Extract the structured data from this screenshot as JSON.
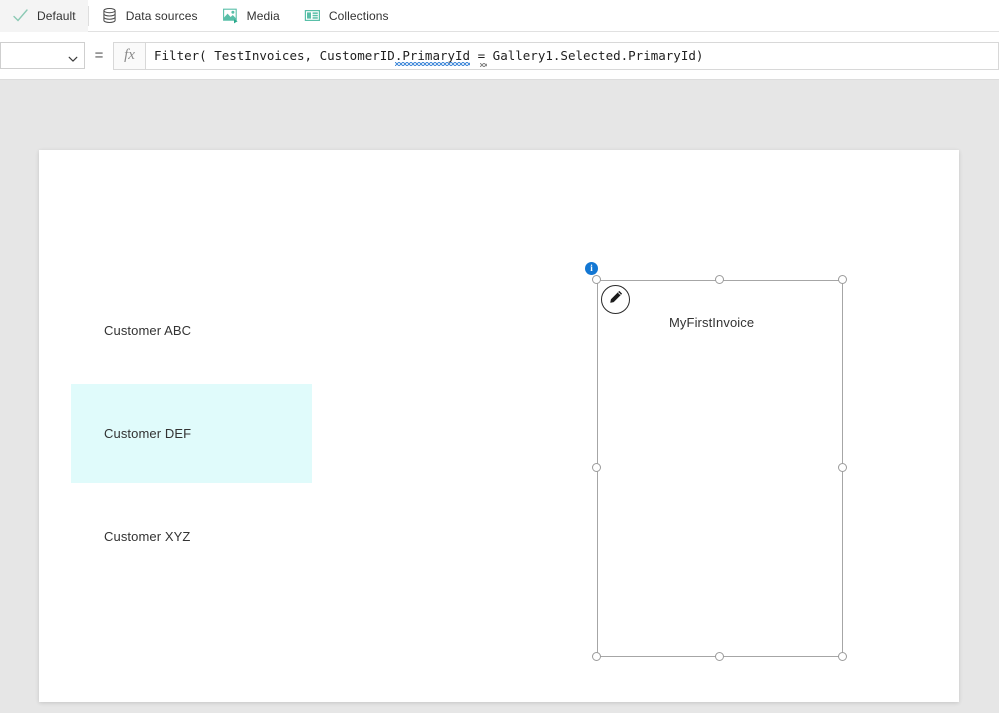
{
  "toolbar": {
    "items": [
      {
        "label": "Default",
        "icon": "checkmark-icon",
        "name": "default"
      },
      {
        "label": "Data sources",
        "icon": "database-icon",
        "name": "data-sources"
      },
      {
        "label": "Media",
        "icon": "media-image-icon",
        "name": "media"
      },
      {
        "label": "Collections",
        "icon": "collections-icon",
        "name": "collections"
      }
    ]
  },
  "formula_bar": {
    "property_value": "",
    "property_placeholder": "",
    "equals_label": "=",
    "fx_label": "fx",
    "formula_segments": {
      "before": "Filter( TestInvoices, CustomerID",
      "squiggly": ".PrimaryId",
      "space1": " ",
      "equals": "=",
      "after": " Gallery1.Selected.PrimaryId)"
    },
    "formula_full": "Filter( TestInvoices, CustomerID.PrimaryId = Gallery1.Selected.PrimaryId)"
  },
  "canvas": {
    "gallery": {
      "items": [
        {
          "label": "Customer ABC",
          "selected": false
        },
        {
          "label": "Customer DEF",
          "selected": true
        },
        {
          "label": "Customer XYZ",
          "selected": false
        }
      ],
      "selected_background": "#e0fbfb"
    },
    "selected_control": {
      "label": "MyFirstInvoice",
      "info_badge": "i",
      "edit_icon": "pencil-icon",
      "handle_count": 8
    }
  },
  "colors": {
    "accent_blue": "#1377d3",
    "toolbar_icon_teal": "#59bfa8",
    "canvas_background": "#e6e6e6",
    "selection_border": "#a6a6a6",
    "text": "#333333"
  }
}
